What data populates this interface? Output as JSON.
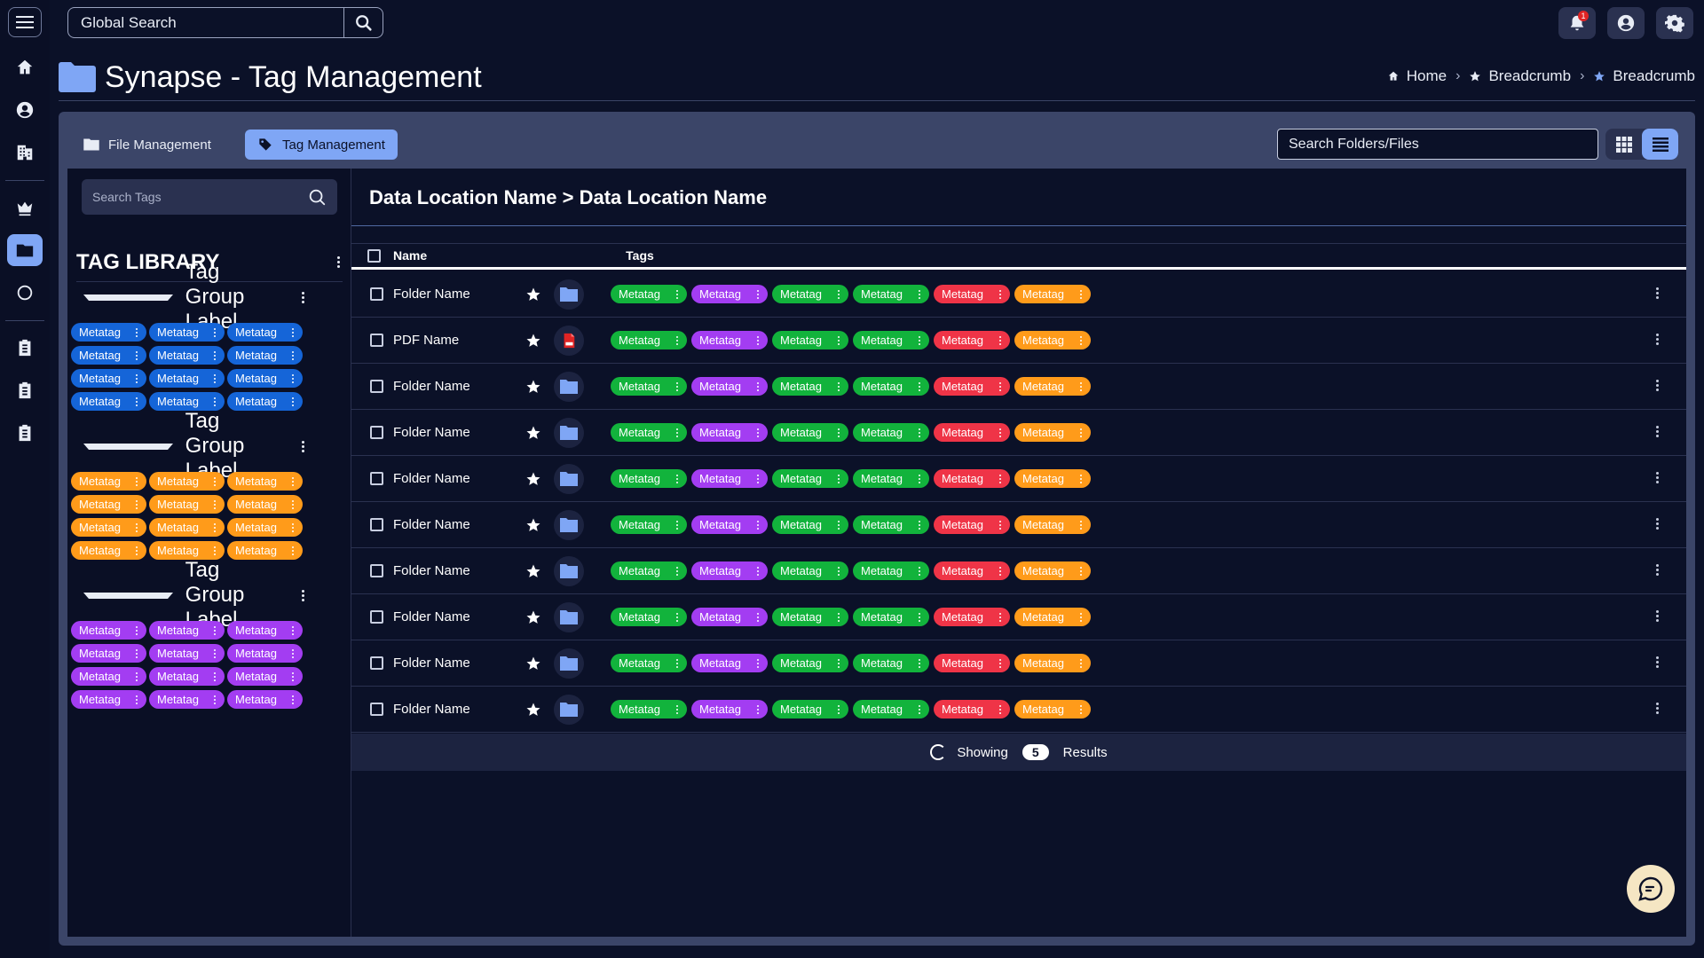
{
  "topbar": {
    "global_search_placeholder": "Global Search",
    "notification_count": "1"
  },
  "page": {
    "title": "Synapse - Tag Management",
    "breadcrumbs": [
      "Home",
      "Breadcrumb",
      "Breadcrumb"
    ]
  },
  "tabs": [
    {
      "label": "File Management",
      "active": false
    },
    {
      "label": "Tag Management",
      "active": true
    }
  ],
  "file_search_placeholder": "Search Folders/Files",
  "tag_library": {
    "search_placeholder": "Search Tags",
    "title": "TAG LIBRARY",
    "groups": [
      {
        "label": "Tag Group Label",
        "color": "#1565d8",
        "chips": [
          "Metatag",
          "Metatag",
          "Metatag",
          "Metatag",
          "Metatag",
          "Metatag",
          "Metatag",
          "Metatag",
          "Metatag",
          "Metatag",
          "Metatag",
          "Metatag"
        ]
      },
      {
        "label": "Tag Group Label",
        "color": "#ff9b1a",
        "chips": [
          "Metatag",
          "Metatag",
          "Metatag",
          "Metatag",
          "Metatag",
          "Metatag",
          "Metatag",
          "Metatag",
          "Metatag",
          "Metatag",
          "Metatag",
          "Metatag"
        ]
      },
      {
        "label": "Tag Group Label",
        "color": "#a33df2",
        "chips": [
          "Metatag",
          "Metatag",
          "Metatag",
          "Metatag",
          "Metatag",
          "Metatag",
          "Metatag",
          "Metatag",
          "Metatag",
          "Metatag",
          "Metatag",
          "Metatag"
        ]
      }
    ]
  },
  "content": {
    "location_title": "Data Location Name > Data Location Name",
    "columns": {
      "name": "Name",
      "tags": "Tags"
    },
    "row_tags": [
      {
        "label": "Metatag",
        "color": "green"
      },
      {
        "label": "Metatag",
        "color": "purple"
      },
      {
        "label": "Metatag",
        "color": "green"
      },
      {
        "label": "Metatag",
        "color": "green"
      },
      {
        "label": "Metatag",
        "color": "red"
      },
      {
        "label": "Metatag",
        "color": "orange"
      }
    ],
    "rows": [
      {
        "name": "Folder Name",
        "type": "folder"
      },
      {
        "name": "PDF Name",
        "type": "pdf"
      },
      {
        "name": "Folder Name",
        "type": "folder"
      },
      {
        "name": "Folder Name",
        "type": "folder"
      },
      {
        "name": "Folder Name",
        "type": "folder"
      },
      {
        "name": "Folder Name",
        "type": "folder"
      },
      {
        "name": "Folder Name",
        "type": "folder"
      },
      {
        "name": "Folder Name",
        "type": "folder"
      },
      {
        "name": "Folder Name",
        "type": "folder"
      },
      {
        "name": "Folder Name",
        "type": "folder"
      }
    ],
    "results": {
      "prefix": "Showing",
      "count": "5",
      "suffix": "Results"
    }
  },
  "colors": {
    "accent": "#7fa6f5",
    "background": "#0b1128",
    "green": "#12b33c",
    "purple": "#a33df2",
    "red": "#ef3447",
    "orange": "#ff9b1a",
    "blue": "#1565d8"
  }
}
